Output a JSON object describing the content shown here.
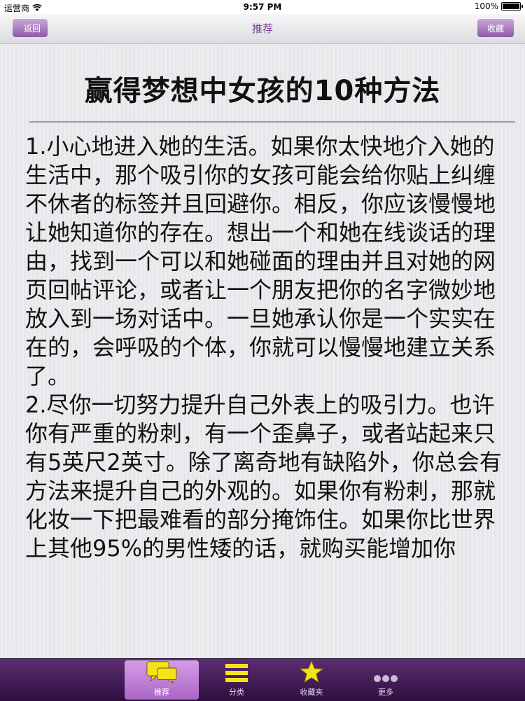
{
  "status_bar": {
    "carrier": "运营商",
    "time": "9:57 PM",
    "battery": "100%"
  },
  "navbar": {
    "back_label": "返回",
    "title": "推荐",
    "favorite_label": "收藏"
  },
  "article": {
    "title": "赢得梦想中女孩的10种方法",
    "paragraphs": [
      "1.小心地进入她的生活。如果你太快地介入她的生活中，那个吸引你的女孩可能会给你贴上纠缠不休者的标签并且回避你。相反，你应该慢慢地让她知道你的存在。想出一个和她在线谈话的理由，找到一个可以和她碰面的理由并且对她的网页回帖评论，或者让一个朋友把你的名字微妙地放入到一场对话中。一旦她承认你是一个实实在在的，会呼吸的个体，你就可以慢慢地建立关系了。",
      "2.尽你一切努力提升自己外表上的吸引力。也许你有严重的粉刺，有一个歪鼻子，或者站起来只有5英尺2英寸。除了离奇地有缺陷外，你总会有方法来提升自己的外观的。如果你有粉刺，那就化妆一下把最难看的部分掩饰住。如果你比世界上其他95%的男性矮的话，就购买能增加你"
    ]
  },
  "tabbar": {
    "tabs": [
      {
        "label": "推荐",
        "icon": "speech-bubbles-icon",
        "active": true
      },
      {
        "label": "分类",
        "icon": "list-lines-icon",
        "active": false
      },
      {
        "label": "收藏夹",
        "icon": "star-icon",
        "active": false
      },
      {
        "label": "更多",
        "icon": "ellipsis-icon",
        "active": false
      }
    ]
  },
  "colors": {
    "accent": "#8e5aa8",
    "tabbar": "#3d1852",
    "tab_active": "#c285da",
    "icon_yellow": "#f5e21a"
  }
}
